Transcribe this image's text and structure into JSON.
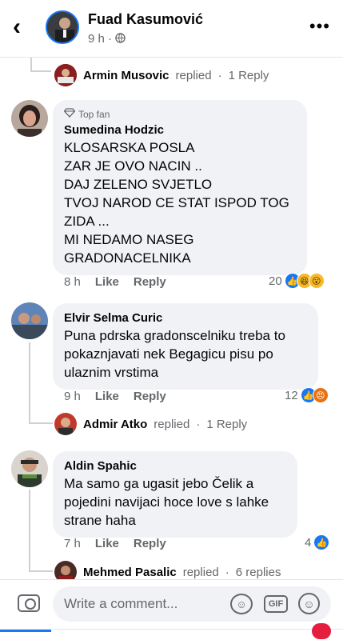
{
  "header": {
    "back_icon": "chevron-left-icon",
    "poster_name": "Fuad Kasumović",
    "post_time": "9 h",
    "audience_icon": "globe-icon",
    "more_icon": "ellipsis-icon"
  },
  "threads": [
    {
      "type": "reply_summary",
      "name": "Armin Musovic",
      "verb": "replied",
      "dot": "·",
      "count": "1 Reply"
    }
  ],
  "comments": [
    {
      "badge": "Top fan",
      "badge_icon": "diamond-icon",
      "author": "Sumedina Hodzic",
      "text": "KLOSARSKA POSLA\nZAR JE OVO NACIN ..\nDAJ ZELENO SVJETLO\nTVOJ NAROD CE STAT ISPOD TOG ZIDA ...\nMI NEDAMO NASEG GRADONACELNIKA",
      "time": "8 h",
      "like": "Like",
      "reply": "Reply",
      "reactions_count": "20",
      "reactions": [
        "like",
        "haha",
        "wow"
      ]
    },
    {
      "author": "Elvir Selma Curic",
      "text": "Puna pdrska gradonscelniku treba to pokaznjavati nek Begagicu pisu po ulaznim vrstima",
      "time": "9 h",
      "like": "Like",
      "reply": "Reply",
      "reactions_count": "12",
      "reactions": [
        "like",
        "angry"
      ],
      "reply_summary": {
        "name": "Admir Atko",
        "verb": "replied",
        "dot": "·",
        "count": "1 Reply"
      }
    },
    {
      "author": "Aldin Spahic",
      "text": "Ma samo ga ugasit jebo Čelik a pojedini navijaci hoce love s lahke strane haha",
      "time": "7 h",
      "like": "Like",
      "reply": "Reply",
      "reactions_count": "4",
      "reactions": [
        "like"
      ],
      "reply_summary": {
        "name": "Mehmed Pasalic",
        "verb": "replied",
        "dot": "·",
        "count": "6 replies"
      }
    }
  ],
  "composer": {
    "camera_icon": "camera-icon",
    "placeholder": "Write a comment...",
    "sticker_icon": "sticker-icon",
    "gif_label": "GIF",
    "emoji_icon": "emoji-icon"
  },
  "colors": {
    "accent": "#1877f2",
    "bubble": "#f0f2f5",
    "muted": "#65676b"
  }
}
